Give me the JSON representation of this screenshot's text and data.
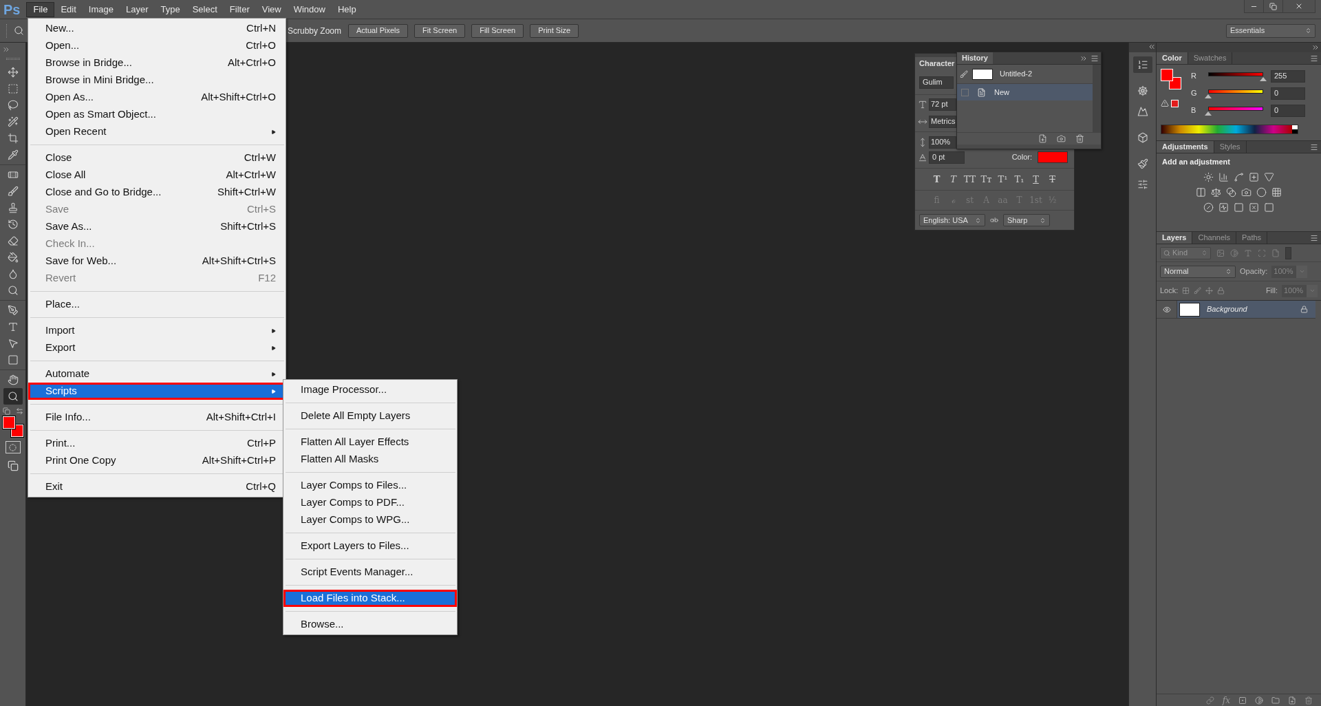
{
  "menu_bar": {
    "logo": "Ps",
    "items": [
      {
        "label": "File",
        "selected": true
      },
      {
        "label": "Edit",
        "selected": false
      },
      {
        "label": "Image",
        "selected": false
      },
      {
        "label": "Layer",
        "selected": false
      },
      {
        "label": "Type",
        "selected": false
      },
      {
        "label": "Select",
        "selected": false
      },
      {
        "label": "Filter",
        "selected": false
      },
      {
        "label": "View",
        "selected": false
      },
      {
        "label": "Window",
        "selected": false
      },
      {
        "label": "Help",
        "selected": false
      }
    ]
  },
  "options_bar": {
    "scrubby_zoom": "Scrubby Zoom",
    "buttons": [
      "Actual Pixels",
      "Fit Screen",
      "Fill Screen",
      "Print Size"
    ],
    "workspace": "Essentials"
  },
  "file_menu": {
    "groups": [
      [
        {
          "label": "New...",
          "shortcut": "Ctrl+N",
          "disabled": false,
          "submenu": false,
          "selected": false
        },
        {
          "label": "Open...",
          "shortcut": "Ctrl+O",
          "disabled": false,
          "submenu": false,
          "selected": false
        },
        {
          "label": "Browse in Bridge...",
          "shortcut": "Alt+Ctrl+O",
          "disabled": false,
          "submenu": false,
          "selected": false
        },
        {
          "label": "Browse in Mini Bridge...",
          "disabled": false,
          "submenu": false,
          "selected": false
        },
        {
          "label": "Open As...",
          "shortcut": "Alt+Shift+Ctrl+O",
          "disabled": false,
          "submenu": false,
          "selected": false
        },
        {
          "label": "Open as Smart Object...",
          "disabled": false,
          "submenu": false,
          "selected": false
        },
        {
          "label": "Open Recent",
          "disabled": false,
          "submenu": true,
          "selected": false
        }
      ],
      [
        {
          "label": "Close",
          "shortcut": "Ctrl+W",
          "disabled": false,
          "submenu": false,
          "selected": false
        },
        {
          "label": "Close All",
          "shortcut": "Alt+Ctrl+W",
          "disabled": false,
          "submenu": false,
          "selected": false
        },
        {
          "label": "Close and Go to Bridge...",
          "shortcut": "Shift+Ctrl+W",
          "disabled": false,
          "submenu": false,
          "selected": false
        },
        {
          "label": "Save",
          "shortcut": "Ctrl+S",
          "disabled": true,
          "submenu": false,
          "selected": false
        },
        {
          "label": "Save As...",
          "shortcut": "Shift+Ctrl+S",
          "disabled": false,
          "submenu": false,
          "selected": false
        },
        {
          "label": "Check In...",
          "disabled": true,
          "submenu": false,
          "selected": false
        },
        {
          "label": "Save for Web...",
          "shortcut": "Alt+Shift+Ctrl+S",
          "disabled": false,
          "submenu": false,
          "selected": false
        },
        {
          "label": "Revert",
          "shortcut": "F12",
          "disabled": true,
          "submenu": false,
          "selected": false
        }
      ],
      [
        {
          "label": "Place...",
          "disabled": false,
          "submenu": false,
          "selected": false
        }
      ],
      [
        {
          "label": "Import",
          "disabled": false,
          "submenu": true,
          "selected": false
        },
        {
          "label": "Export",
          "disabled": false,
          "submenu": true,
          "selected": false
        }
      ],
      [
        {
          "label": "Automate",
          "disabled": false,
          "submenu": true,
          "selected": false
        },
        {
          "label": "Scripts",
          "disabled": false,
          "submenu": true,
          "selected": true
        }
      ],
      [
        {
          "label": "File Info...",
          "shortcut": "Alt+Shift+Ctrl+I",
          "disabled": false,
          "submenu": false,
          "selected": false
        }
      ],
      [
        {
          "label": "Print...",
          "shortcut": "Ctrl+P",
          "disabled": false,
          "submenu": false,
          "selected": false
        },
        {
          "label": "Print One Copy",
          "shortcut": "Alt+Shift+Ctrl+P",
          "disabled": false,
          "submenu": false,
          "selected": false
        }
      ],
      [
        {
          "label": "Exit",
          "shortcut": "Ctrl+Q",
          "disabled": false,
          "submenu": false,
          "selected": false
        }
      ]
    ]
  },
  "scripts_menu": {
    "groups": [
      [
        {
          "label": "Image Processor...",
          "selected": false
        }
      ],
      [
        {
          "label": "Delete All Empty Layers",
          "selected": false
        }
      ],
      [
        {
          "label": "Flatten All Layer Effects",
          "selected": false
        },
        {
          "label": "Flatten All Masks",
          "selected": false
        }
      ],
      [
        {
          "label": "Layer Comps to Files...",
          "selected": false
        },
        {
          "label": "Layer Comps to PDF...",
          "selected": false
        },
        {
          "label": "Layer Comps to WPG...",
          "selected": false
        }
      ],
      [
        {
          "label": "Export Layers to Files...",
          "selected": false
        }
      ],
      [
        {
          "label": "Script Events Manager...",
          "selected": false
        }
      ],
      [
        {
          "label": "Load Files into Stack...",
          "selected": true
        }
      ],
      [
        {
          "label": "Browse...",
          "selected": false
        }
      ]
    ]
  },
  "character_panel": {
    "tab": "Character",
    "font": "Gulim",
    "size": "72 pt",
    "kerning": "Metrics",
    "vertical_scale": "100%",
    "baseline_shift": "0 pt",
    "color_label": "Color:",
    "styles": [
      {
        "kind": "bold",
        "label": "T"
      },
      {
        "kind": "italic",
        "label": "T"
      },
      {
        "kind": "plain",
        "label": "TT"
      },
      {
        "kind": "plain",
        "label": "Tᴛ"
      },
      {
        "kind": "plain",
        "label": "T¹"
      },
      {
        "kind": "plain",
        "label": "T₁"
      },
      {
        "kind": "underline",
        "label": "T"
      },
      {
        "kind": "strike",
        "label": "T"
      }
    ],
    "opentype": [
      {
        "label": "fi",
        "disabled": true
      },
      {
        "label": "ℴ",
        "disabled": true
      },
      {
        "label": "st",
        "disabled": true
      },
      {
        "label": "A",
        "disabled": true
      },
      {
        "label": "aa",
        "disabled": true
      },
      {
        "label": "T",
        "disabled": true
      },
      {
        "label": "1st",
        "disabled": true
      },
      {
        "label": "½",
        "disabled": true
      }
    ],
    "language": "English: USA",
    "antialias": "Sharp"
  },
  "history_panel": {
    "tab": "History",
    "snapshot": "Untitled-2",
    "states": [
      {
        "label": "New",
        "selected": true
      }
    ]
  },
  "color_panel": {
    "tabs": [
      {
        "label": "Color",
        "selected": true
      },
      {
        "label": "Swatches",
        "selected": false
      }
    ],
    "channels": [
      {
        "name": "R",
        "value": "255",
        "level": 1
      },
      {
        "name": "G",
        "value": "0",
        "level": 0
      },
      {
        "name": "B",
        "value": "0",
        "level": 0
      }
    ]
  },
  "adjustments_panel": {
    "tabs": [
      {
        "label": "Adjustments",
        "selected": true
      },
      {
        "label": "Styles",
        "selected": false
      }
    ],
    "heading": "Add an adjustment"
  },
  "layers_panel": {
    "tabs": [
      {
        "label": "Layers",
        "selected": true
      },
      {
        "label": "Channels",
        "selected": false
      },
      {
        "label": "Paths",
        "selected": false
      }
    ],
    "filter": "Kind",
    "blend_mode": "Normal",
    "opacity_label": "Opacity:",
    "opacity": "100%",
    "lock_label": "Lock:",
    "fill_label": "Fill:",
    "fill": "100%",
    "layers": [
      {
        "name": "Background",
        "selected": true,
        "visible": true,
        "locked": true
      }
    ],
    "fx": "fx"
  }
}
